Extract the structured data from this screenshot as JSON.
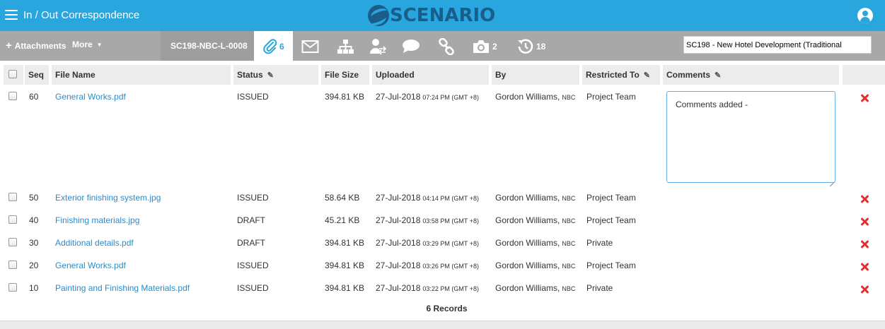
{
  "header": {
    "title": "In / Out Correspondence",
    "logo_text": "SCENARIO",
    "accent_color": "#2aa6df",
    "logo_color": "#1b5d8a"
  },
  "toolbar": {
    "attachments_label": "Attachments",
    "more_label": "More",
    "doc_ref": "SC198-NBC-L-0008",
    "tabs": [
      {
        "icon": "paperclip-icon",
        "count": "6",
        "active": true
      },
      {
        "icon": "envelope-icon",
        "count": ""
      },
      {
        "icon": "hierarchy-icon",
        "count": ""
      },
      {
        "icon": "user-transfer-icon",
        "count": ""
      },
      {
        "icon": "speech-bubble-icon",
        "count": ""
      },
      {
        "icon": "link-icon",
        "count": ""
      },
      {
        "icon": "camera-icon",
        "count": "2"
      },
      {
        "icon": "history-icon",
        "count": "18"
      }
    ],
    "project_select": "SC198  -  New Hotel Development (Traditional"
  },
  "table": {
    "columns": {
      "seq": "Seq",
      "file_name": "File Name",
      "status": "Status",
      "file_size": "File Size",
      "uploaded": "Uploaded",
      "by": "By",
      "restricted_to": "Restricted To",
      "comments": "Comments"
    },
    "rows": [
      {
        "seq": "60",
        "file_name": "General Works.pdf",
        "status": "ISSUED",
        "file_size": "394.81 KB",
        "date": "27-Jul-2018",
        "time": "07:24 PM (GMT +8)",
        "by": "Gordon Williams,",
        "org": "NBC",
        "restricted_to": "Project Team",
        "comment": "Comments added -"
      },
      {
        "seq": "50",
        "file_name": "Exterior finishing system.jpg",
        "status": "ISSUED",
        "file_size": "58.64 KB",
        "date": "27-Jul-2018",
        "time": "04:14 PM (GMT +8)",
        "by": "Gordon Williams,",
        "org": "NBC",
        "restricted_to": "Project Team"
      },
      {
        "seq": "40",
        "file_name": "Finishing materials.jpg",
        "status": "DRAFT",
        "file_size": "45.21 KB",
        "date": "27-Jul-2018",
        "time": "03:58 PM (GMT +8)",
        "by": "Gordon Williams,",
        "org": "NBC",
        "restricted_to": "Project Team"
      },
      {
        "seq": "30",
        "file_name": "Additional details.pdf",
        "status": "DRAFT",
        "file_size": "394.81 KB",
        "date": "27-Jul-2018",
        "time": "03:29 PM (GMT +8)",
        "by": "Gordon Williams,",
        "org": "NBC",
        "restricted_to": "Private"
      },
      {
        "seq": "20",
        "file_name": "General Works.pdf",
        "status": "ISSUED",
        "file_size": "394.81 KB",
        "date": "27-Jul-2018",
        "time": "03:26 PM (GMT +8)",
        "by": "Gordon Williams,",
        "org": "NBC",
        "restricted_to": "Project Team"
      },
      {
        "seq": "10",
        "file_name": "Painting and Finishing Materials.pdf",
        "status": "ISSUED",
        "file_size": "394.81 KB",
        "date": "27-Jul-2018",
        "time": "03:22 PM (GMT +8)",
        "by": "Gordon Williams,",
        "org": "NBC",
        "restricted_to": "Private"
      }
    ],
    "records_label": "6  Records"
  }
}
